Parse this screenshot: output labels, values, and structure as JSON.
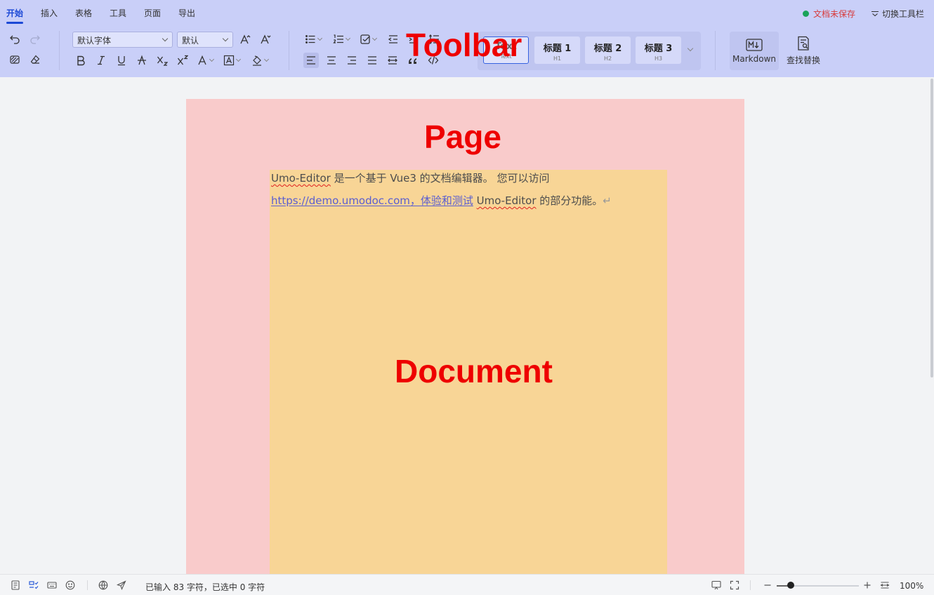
{
  "toolbar": {
    "tabs": [
      "开始",
      "插入",
      "表格",
      "工具",
      "页面",
      "导出"
    ],
    "active_tab": "开始",
    "save_status": "文档未保存",
    "switch_toolbar_label": "切换工具栏",
    "font_family": "默认字体",
    "font_size": "默认",
    "styles": [
      {
        "title": "Text",
        "sub": "Text"
      },
      {
        "title": "标题 1",
        "sub": "H1"
      },
      {
        "title": "标题 2",
        "sub": "H2"
      },
      {
        "title": "标题 3",
        "sub": "H3"
      }
    ],
    "markdown_label": "Markdown",
    "find_replace_label": "查找替换",
    "annotation": "Toolbar"
  },
  "page": {
    "annotation": "Page"
  },
  "document": {
    "annotation": "Document",
    "line1": {
      "product": "Umo-Editor",
      "text": " 是一个基于 Vue3 的文档编辑器。 您可以访问"
    },
    "line2": {
      "link": "https://demo.umodoc.com，体验和测试",
      "space": " ",
      "product": "Umo-Editor",
      "text": " 的部分功能。",
      "para_mark": "↵"
    }
  },
  "statusbar": {
    "word_count": "已输入 83 字符，已选中 0 字符",
    "zoom_level": "100%",
    "zoom_fraction": 0.17
  },
  "colors": {
    "toolbar_bg": "#c9cff8",
    "accent": "#1c49d6",
    "page_bg": "#f9cbcb",
    "document_bg": "#f8d596",
    "annotation_red": "#ee0000"
  },
  "icons": [
    "undo-icon",
    "redo-icon",
    "format-painter-icon",
    "clear-format-icon",
    "bold-icon",
    "italic-icon",
    "underline-icon",
    "strikethrough-icon",
    "subscript-icon",
    "superscript-icon",
    "font-color-icon",
    "highlight-icon",
    "bg-color-icon",
    "bullet-list-icon",
    "ordered-list-icon",
    "task-list-icon",
    "outdent-icon",
    "indent-icon",
    "line-height-icon",
    "align-left-icon",
    "align-center-icon",
    "align-right-icon",
    "justify-icon",
    "distribute-icon",
    "quote-icon",
    "code-icon",
    "markdown-icon",
    "find-replace-icon"
  ]
}
